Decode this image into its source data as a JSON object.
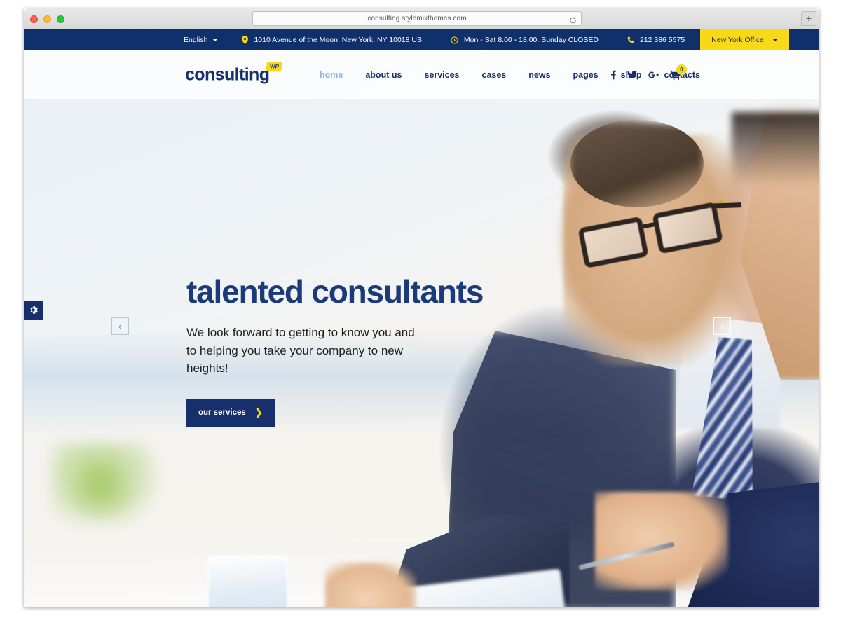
{
  "browser": {
    "url": "consulting.stylemixthemes.com",
    "reload_icon": "reload-icon",
    "new_tab_label": "+"
  },
  "topbar": {
    "language": {
      "label": "English",
      "caret": "caret-down-icon"
    },
    "address": {
      "icon": "map-pin-icon",
      "text": "1010 Avenue of the Moon, New York, NY 10018 US."
    },
    "hours": {
      "icon": "clock-icon",
      "text": "Mon - Sat 8.00 - 18.00. Sunday CLOSED"
    },
    "phone": {
      "icon": "phone-icon",
      "text": "212 386 5575"
    },
    "office": {
      "label": "New York Office",
      "caret": "caret-down-icon"
    },
    "bg_color": "#10306b",
    "accent_color": "#f7d917"
  },
  "header": {
    "logo": {
      "text": "consulting",
      "badge": "WP"
    },
    "nav": [
      {
        "label": "home",
        "active": true
      },
      {
        "label": "about us",
        "active": false
      },
      {
        "label": "services",
        "active": false
      },
      {
        "label": "cases",
        "active": false
      },
      {
        "label": "news",
        "active": false
      },
      {
        "label": "pages",
        "active": false
      },
      {
        "label": "shop",
        "active": false
      },
      {
        "label": "contacts",
        "active": false
      }
    ],
    "social": [
      {
        "name": "facebook-icon",
        "glyph": "f"
      },
      {
        "name": "twitter-icon",
        "glyph": "t"
      },
      {
        "name": "google-plus-icon",
        "glyph": "G+"
      }
    ],
    "cart": {
      "icon": "shopping-cart-icon",
      "count": "0"
    }
  },
  "hero": {
    "title": "talented consultants",
    "subtitle": "We look forward to getting to know you and to helping you take your company to new heights!",
    "cta": {
      "label": "our services",
      "arrow": "chevron-right-icon"
    },
    "settings_icon": "gear-icon",
    "prev_label": "‹",
    "next_label": "›",
    "title_color": "#1b3a7a",
    "cta_bg": "#17306b"
  }
}
